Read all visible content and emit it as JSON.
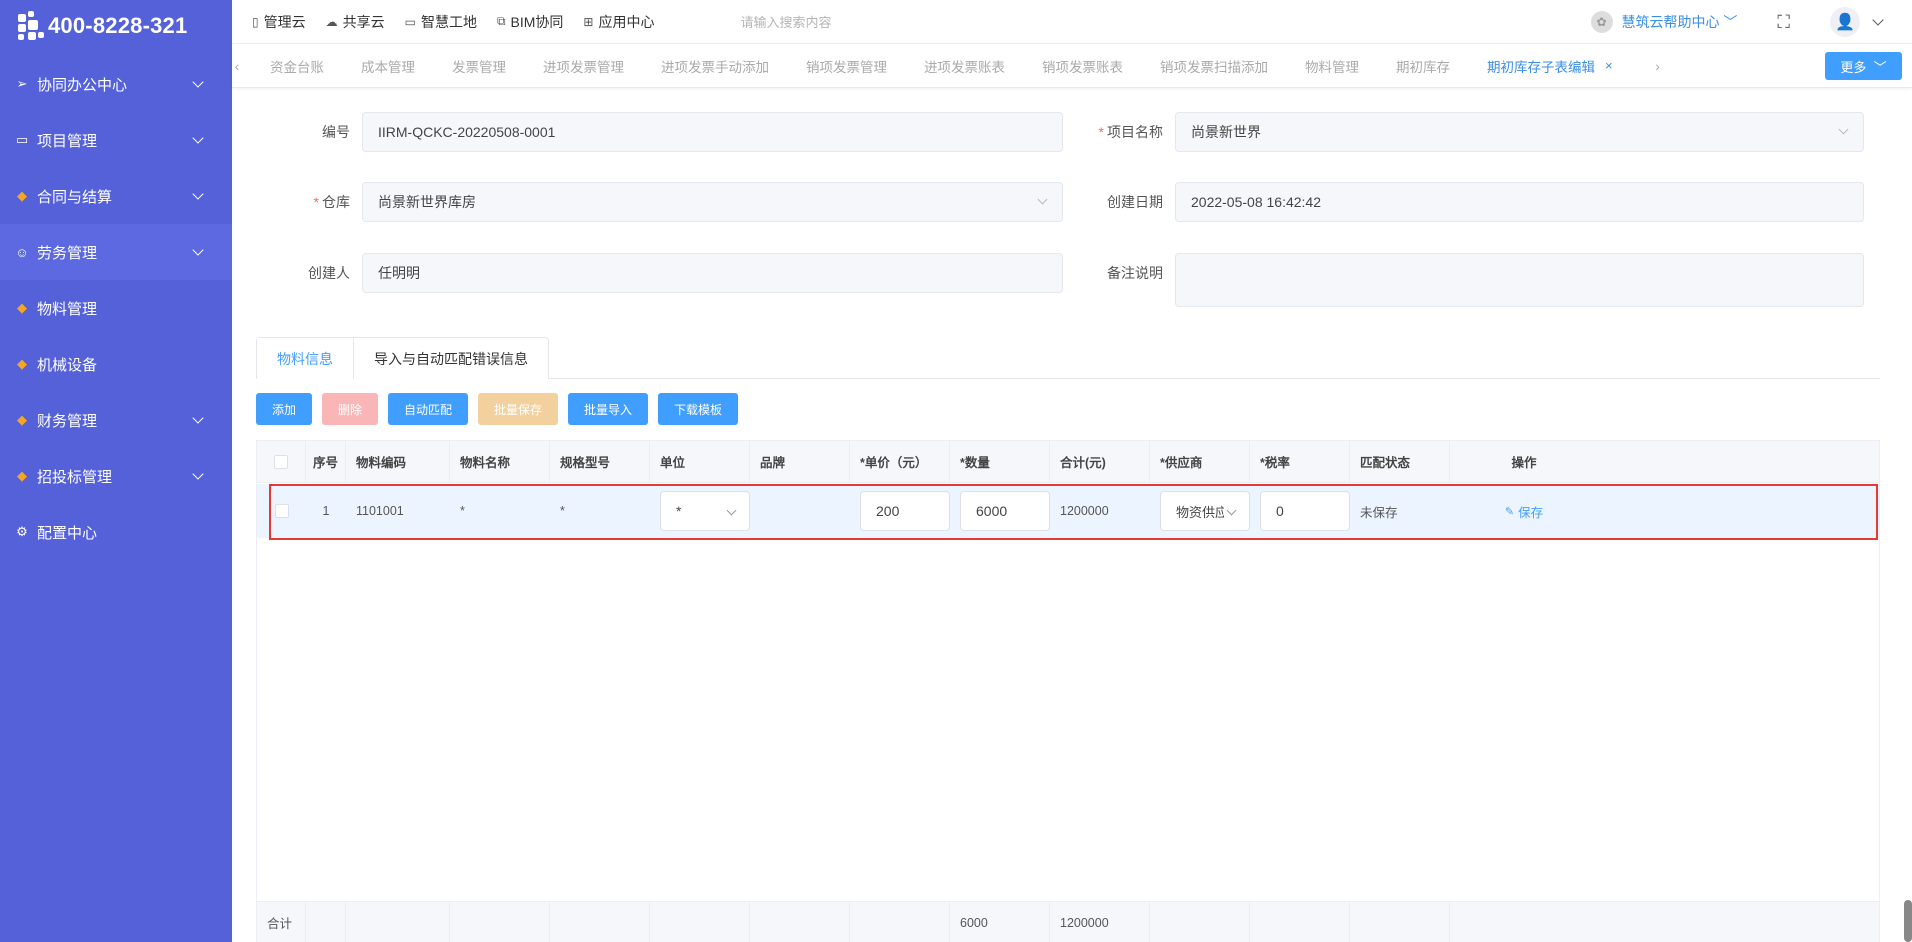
{
  "brand": {
    "phone": "400-8228-321"
  },
  "sidebar": {
    "items": [
      {
        "label": "协同办公中心",
        "icon": "send-icon",
        "expandable": true
      },
      {
        "label": "项目管理",
        "icon": "book-icon",
        "expandable": true
      },
      {
        "label": "合同与结算",
        "icon": "gem-icon",
        "expandable": true
      },
      {
        "label": "劳务管理",
        "icon": "worker-icon",
        "expandable": true
      },
      {
        "label": "物料管理",
        "icon": "gem-icon",
        "expandable": false
      },
      {
        "label": "机械设备",
        "icon": "gem-icon",
        "expandable": false
      },
      {
        "label": "财务管理",
        "icon": "gem-icon",
        "expandable": true
      },
      {
        "label": "招投标管理",
        "icon": "gem-icon",
        "expandable": true
      },
      {
        "label": "配置中心",
        "icon": "gear-icon",
        "expandable": false
      }
    ]
  },
  "topbar": {
    "links": [
      "管理云",
      "共享云",
      "智慧工地",
      "BIM协同",
      "应用中心"
    ],
    "search_placeholder": "请输入搜索内容",
    "help": "慧筑云帮助中心"
  },
  "tabs": {
    "items": [
      "资金台账",
      "成本管理",
      "发票管理",
      "进项发票管理",
      "进项发票手动添加",
      "销项发票管理",
      "进项发票账表",
      "销项发票账表",
      "销项发票扫描添加",
      "物料管理",
      "期初库存",
      "期初库存子表编辑"
    ],
    "active": "期初库存子表编辑",
    "more": "更多"
  },
  "form": {
    "code_label": "编号",
    "code_value": "IIRM-QCKC-20220508-0001",
    "project_label": "项目名称",
    "project_value": "尚景新世界",
    "warehouse_label": "仓库",
    "warehouse_value": "尚景新世界库房",
    "created_date_label": "创建日期",
    "created_date_value": "2022-05-08 16:42:42",
    "creator_label": "创建人",
    "creator_value": "任明明",
    "remark_label": "备注说明",
    "remark_value": ""
  },
  "subtabs": [
    "物料信息",
    "导入与自动匹配错误信息"
  ],
  "buttons": {
    "add": "添加",
    "delete": "删除",
    "auto_match": "自动匹配",
    "batch_save": "批量保存",
    "batch_import": "批量导入",
    "download_template": "下载模板"
  },
  "table": {
    "headers": [
      "序号",
      "物料编码",
      "物料名称",
      "规格型号",
      "单位",
      "品牌",
      "*单价（元）",
      "*数量",
      "合计(元)",
      "*供应商",
      "*税率",
      "匹配状态",
      "操作"
    ],
    "rows": [
      {
        "index": "1",
        "code": "1101001",
        "name": "*",
        "spec": "*",
        "unit": "*",
        "brand": "",
        "price": "200",
        "qty": "6000",
        "total": "1200000",
        "supplier": "物资供应",
        "tax": "0",
        "status": "未保存",
        "action": "保存"
      }
    ],
    "footer": {
      "label": "合计",
      "qty": "6000",
      "total": "1200000"
    }
  }
}
